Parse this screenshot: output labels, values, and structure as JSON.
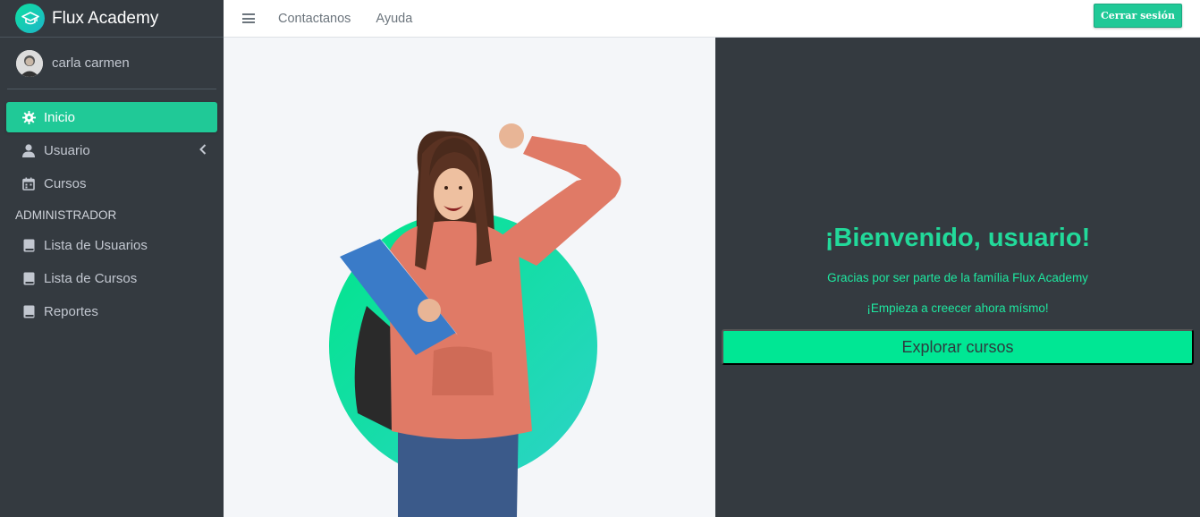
{
  "brand": {
    "name": "Flux Academy",
    "logo_icon": "graduation-cap-icon"
  },
  "user": {
    "name": "carla carmen"
  },
  "sidebar": {
    "items": [
      {
        "label": "Inicio",
        "icon": "gear-icon",
        "active": true
      },
      {
        "label": "Usuario",
        "icon": "user-icon",
        "has_chevron": true
      },
      {
        "label": "Cursos",
        "icon": "calendar-icon"
      }
    ],
    "admin_header": "ADMINISTRADOR",
    "admin_items": [
      {
        "label": "Lista de Usuarios",
        "icon": "book-icon"
      },
      {
        "label": "Lista de Cursos",
        "icon": "book-icon"
      },
      {
        "label": "Reportes",
        "icon": "book-icon"
      }
    ]
  },
  "topbar": {
    "links": [
      "Contactanos",
      "Ayuda"
    ],
    "logout_label": "Cerrar sesión"
  },
  "hero": {
    "title": "¡Bienvenido, usuario!",
    "subtitle1": "Gracias por ser parte de la família Flux Academy",
    "subtitle2": "¡Empieza a creecer ahora mísmo!",
    "cta_label": "Explorar cursos"
  },
  "colors": {
    "accent": "#20c997",
    "cta": "#00e794",
    "sidebar_bg": "#343a40",
    "title": "#22d99a"
  }
}
